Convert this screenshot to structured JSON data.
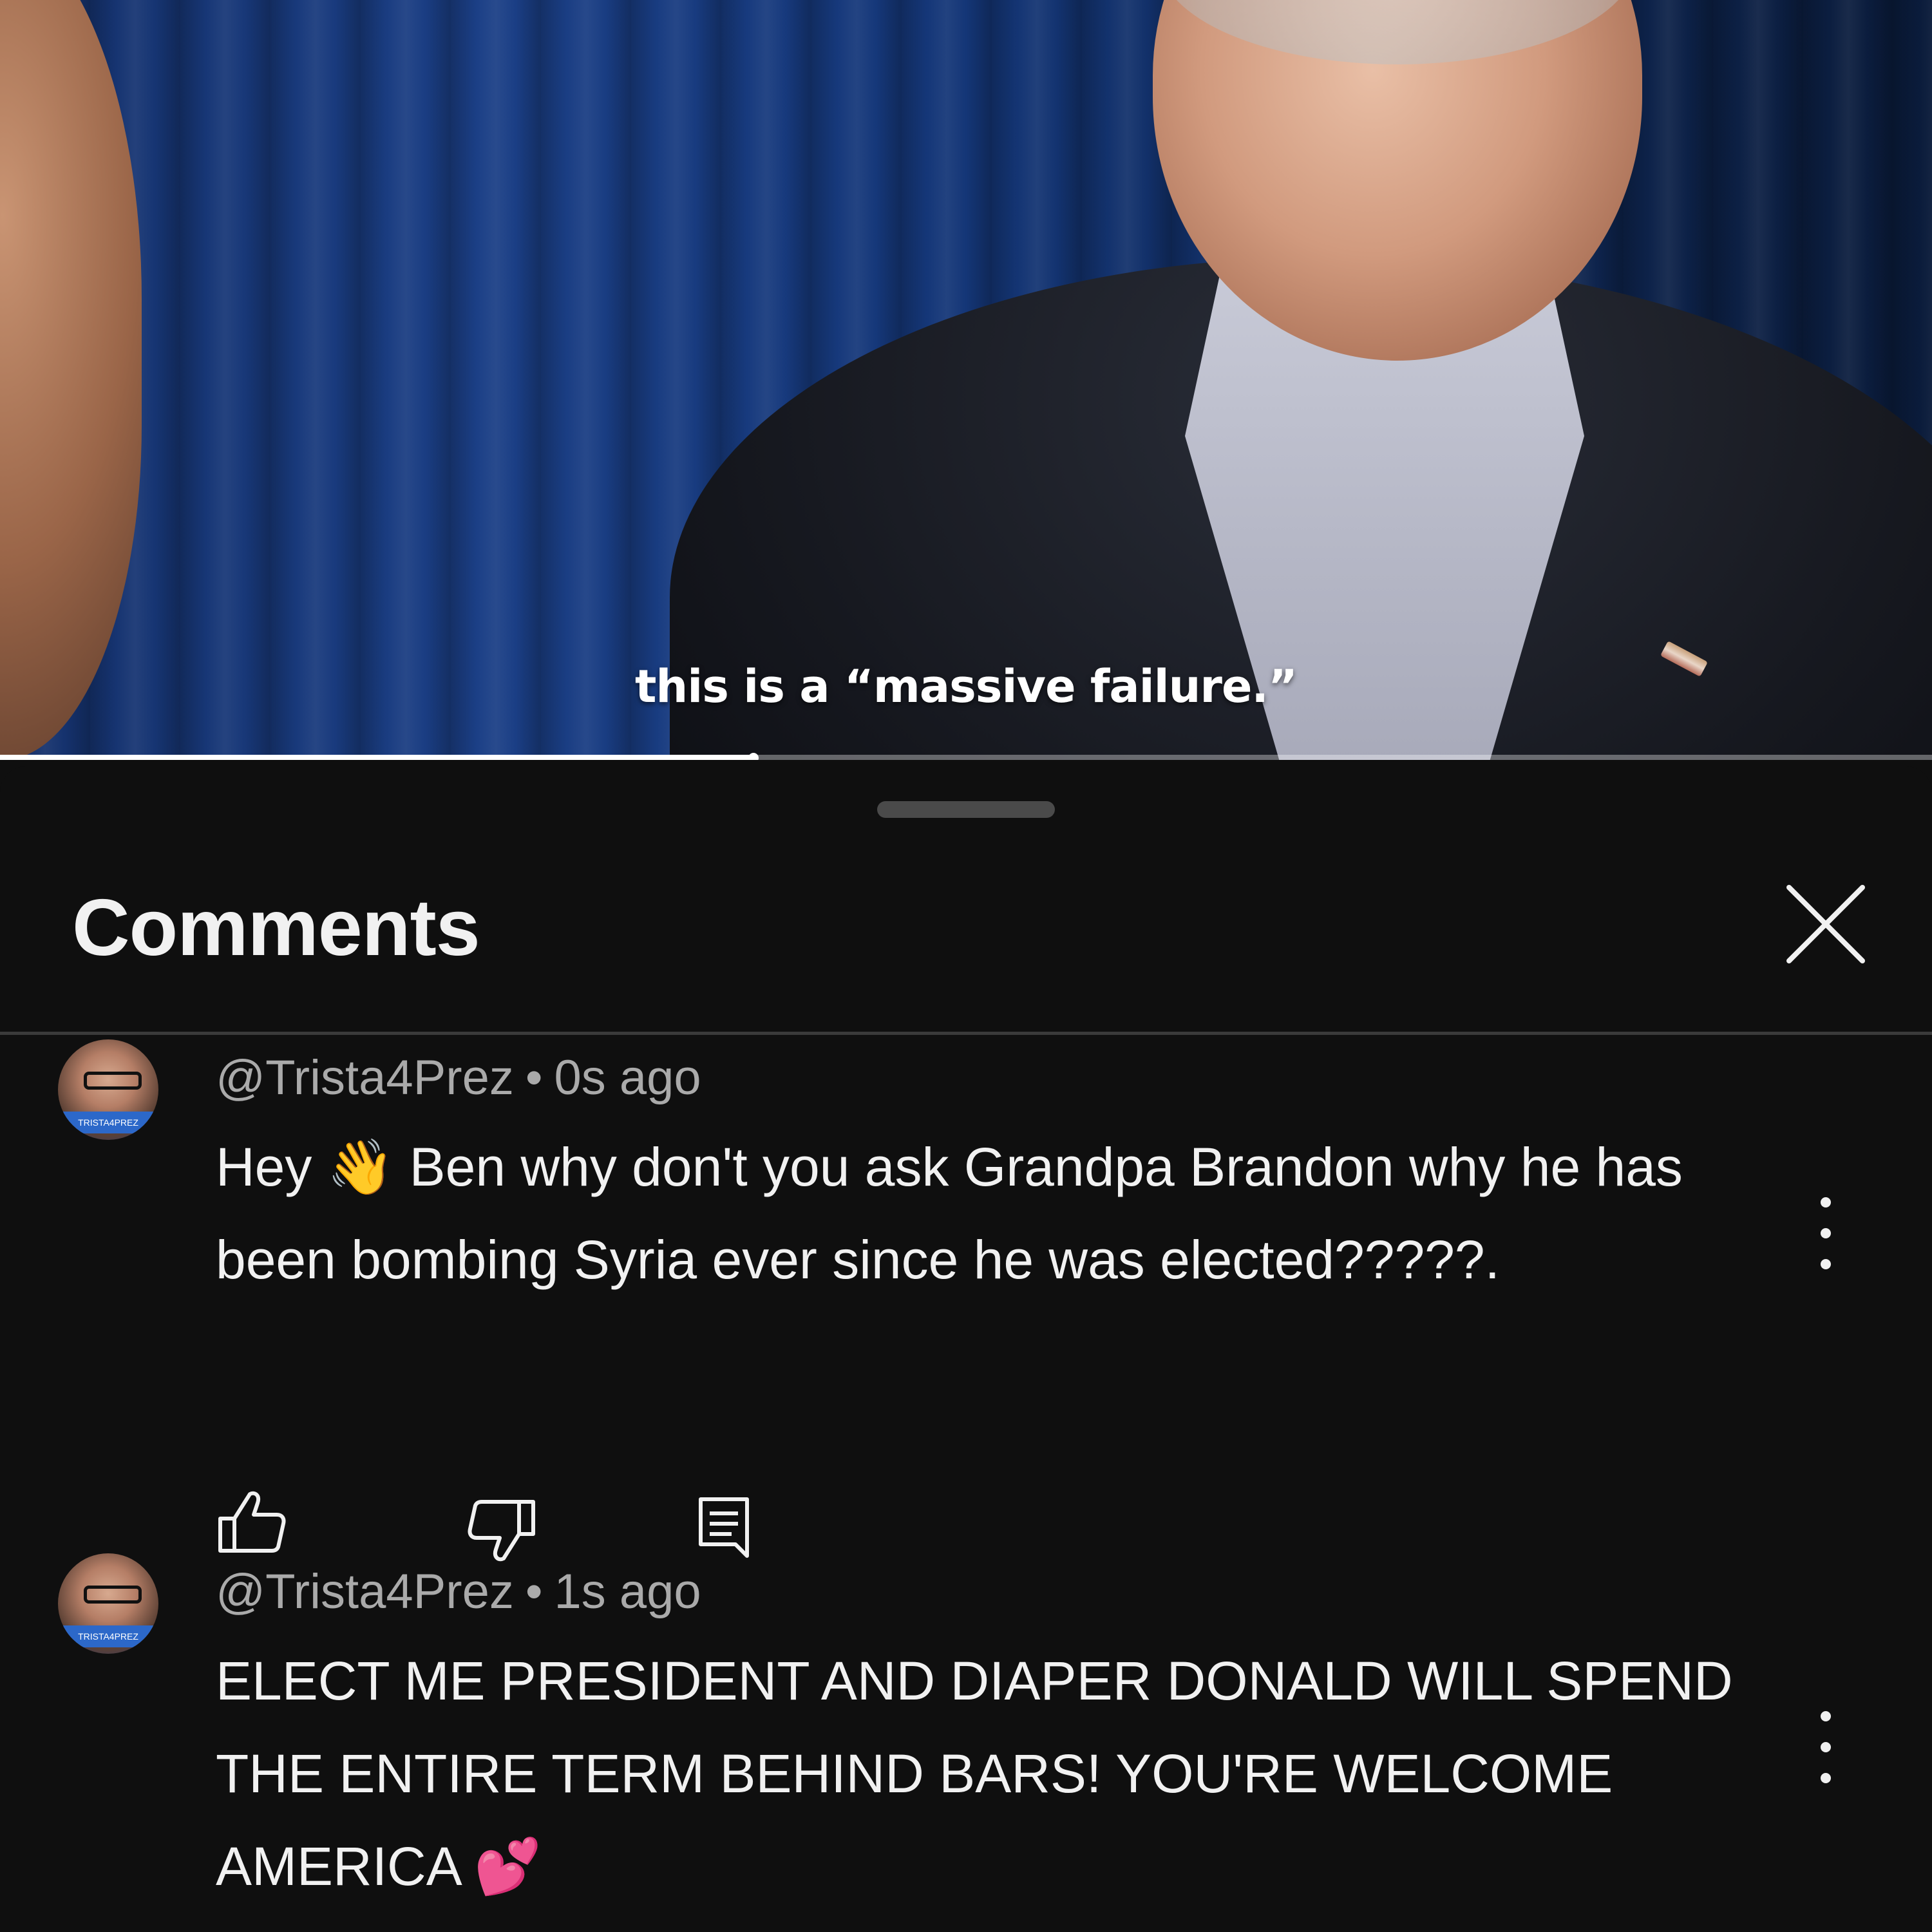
{
  "video": {
    "caption": "this is a “massive failure.”",
    "progress_fraction": 0.39
  },
  "sheet": {
    "title": "Comments",
    "close_icon": "close-icon"
  },
  "comments": [
    {
      "author": "@Trista4Prez",
      "separator": "•",
      "time": "0s ago",
      "text_before_emoji": "Hey ",
      "emoji": "👋",
      "text_after_emoji": " Ben why don't you ask Grandpa Brandon why he has been bombing Syria ever since he was elected?????.",
      "avatar_badge": "TRISTA4PREZ",
      "actions": [
        "like-icon",
        "dislike-icon",
        "reply-icon"
      ]
    },
    {
      "author": "@Trista4Prez",
      "separator": "•",
      "time": "1s ago",
      "text": "ELECT ME PRESIDENT AND DIAPER DONALD WILL SPEND THE ENTIRE TERM BEHIND BARS! YOU'RE WELCOME AMERICA ",
      "emoji": "💕",
      "avatar_badge": "TRISTA4PREZ"
    }
  ]
}
